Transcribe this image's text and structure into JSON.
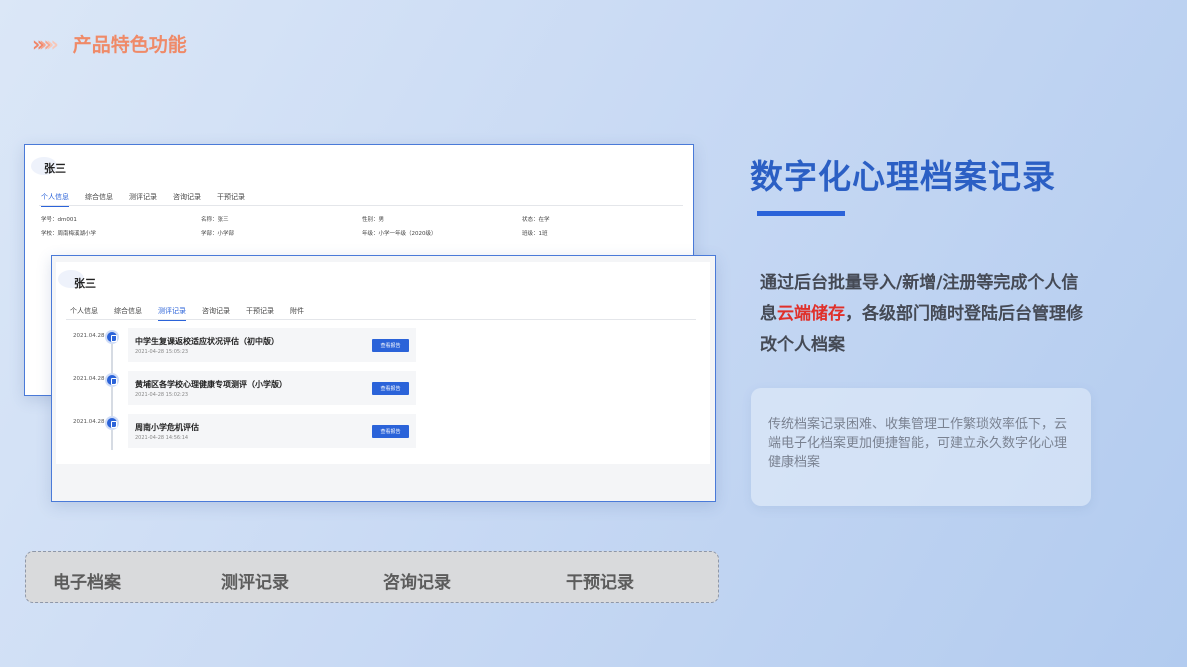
{
  "header": {
    "chevrons": [
      "»",
      "»",
      "»"
    ],
    "title": "产品特色功能"
  },
  "back_panel": {
    "name": "张三",
    "tabs": [
      "个人信息",
      "综合信息",
      "测评记录",
      "咨询记录",
      "干预记录"
    ],
    "info": [
      [
        "学号：dm001",
        "名称：张三",
        "性别：男",
        "状态：在学"
      ],
      [
        "学校：周南梅溪湖小学",
        "学部：小学部",
        "年级：小学一年级（2020级）",
        "班级：1班"
      ]
    ]
  },
  "front_panel": {
    "name": "张三",
    "tabs": [
      "个人信息",
      "综合信息",
      "测评记录",
      "咨询记录",
      "干预记录",
      "附件"
    ],
    "records": [
      {
        "date": "2021.04.28",
        "title": "中学生复课返校适应状况评估（初中版）",
        "time": "2021-04-28 15:05:23",
        "button": "查看报告"
      },
      {
        "date": "2021.04.28",
        "title": "黄埔区各学校心理健康专项测评（小学版）",
        "time": "2021-04-28 15:02:23",
        "button": "查看报告"
      },
      {
        "date": "2021.04.28",
        "title": "周南小学危机评估",
        "time": "2021-04-28 14:56:14",
        "button": "查看报告"
      }
    ]
  },
  "bottom_bar": {
    "items": [
      "电子档案",
      "测评记录",
      "咨询记录",
      "干预记录"
    ]
  },
  "right": {
    "title": "数字化心理档案记录",
    "desc_part1": "通过后台批量导入/新增/注册等完成个人信息",
    "desc_highlight": "云端储存",
    "desc_part2": "，各级部门随时登陆后台管理修改个人档案",
    "note": "传统档案记录困难、收集管理工作繁琐效率低下，云端电子化档案更加便捷智能，可建立永久数字化心理健康档案"
  },
  "colors": {
    "accent": "#2b63d9",
    "title_blue": "#2b5fc4",
    "highlight_red": "#e0302a",
    "header_orange": "#ef8a68"
  }
}
